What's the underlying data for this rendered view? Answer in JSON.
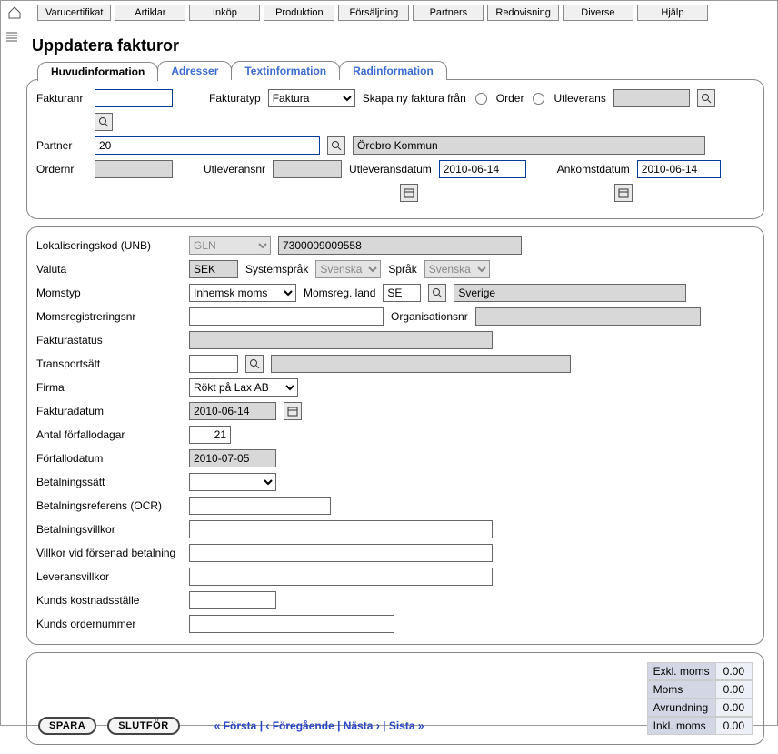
{
  "nav": {
    "items": [
      "Varucertifikat",
      "Artiklar",
      "Inköp",
      "Produktion",
      "Försäljning",
      "Partners",
      "Redovisning",
      "Diverse",
      "Hjälp"
    ]
  },
  "title": "Uppdatera fakturor",
  "tabs": [
    "Huvudinformation",
    "Adresser",
    "Textinformation",
    "Radinformation"
  ],
  "head": {
    "fakturanr_label": "Fakturanr",
    "fakturatyp_label": "Fakturatyp",
    "fakturatyp_value": "Faktura",
    "skapa_label": "Skapa ny faktura från",
    "order_label": "Order",
    "utleverans_label": "Utleverans",
    "partner_label": "Partner",
    "partner_value": "20",
    "partner_name": "Örebro Kommun",
    "ordernr_label": "Ordernr",
    "utleveransnr_label": "Utleveransnr",
    "utleveransdatum_label": "Utleveransdatum",
    "utleveransdatum_value": "2010-06-14",
    "ankomstdatum_label": "Ankomstdatum",
    "ankomstdatum_value": "2010-06-14"
  },
  "body": {
    "lokkod_label": "Lokaliseringskod (UNB)",
    "lokkod_type": "GLN",
    "lokkod_value": "7300009009558",
    "valuta_label": "Valuta",
    "valuta_value": "SEK",
    "systemsprak_label": "Systemspråk",
    "systemsprak_value": "Svenska",
    "sprak_label": "Språk",
    "sprak_value": "Svenska",
    "momstyp_label": "Momstyp",
    "momstyp_value": "Inhemsk moms",
    "momsreg_land_label": "Momsreg. land",
    "momsreg_land_value": "SE",
    "momsreg_land_name": "Sverige",
    "momsreg_label": "Momsregistreringsnr",
    "orgnr_label": "Organisationsnr",
    "fakturastatus_label": "Fakturastatus",
    "transportsatt_label": "Transportsätt",
    "firma_label": "Firma",
    "firma_value": "Rökt på Lax AB",
    "fakturadatum_label": "Fakturadatum",
    "fakturadatum_value": "2010-06-14",
    "antal_label": "Antal förfallodagar",
    "antal_value": "21",
    "forfallo_label": "Förfallodatum",
    "forfallo_value": "2010-07-05",
    "betalsatt_label": "Betalningssätt",
    "betalref_label": "Betalningsreferens (OCR)",
    "betalvillkor_label": "Betalningsvillkor",
    "villkor_sen_label": "Villkor vid försenad betalning",
    "leveransvillkor_label": "Leveransvillkor",
    "kunds_kost_label": "Kunds kostnadsställe",
    "kunds_order_label": "Kunds ordernummer"
  },
  "footer": {
    "spara": "SPARA",
    "slutfor": "SLUTFÖR",
    "pager_first": "« Första",
    "pager_prev": "‹ Föregående",
    "pager_next": "Nästa ›",
    "pager_last": "Sista »",
    "totals": {
      "exkl_label": "Exkl. moms",
      "exkl_val": "0.00",
      "moms_label": "Moms",
      "moms_val": "0.00",
      "avr_label": "Avrundning",
      "avr_val": "0.00",
      "inkl_label": "Inkl. moms",
      "inkl_val": "0.00"
    }
  }
}
